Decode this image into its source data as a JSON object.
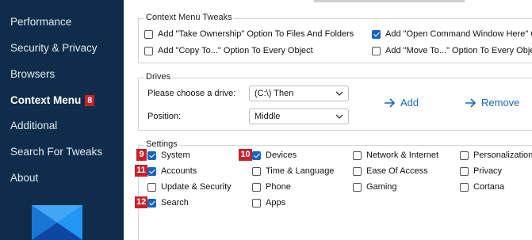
{
  "sidebar": {
    "items": [
      {
        "label": "Performance"
      },
      {
        "label": "Security & Privacy"
      },
      {
        "label": "Browsers"
      },
      {
        "label": "Context Menu",
        "badge": "8"
      },
      {
        "label": "Additional"
      },
      {
        "label": "Search For Tweaks"
      },
      {
        "label": "About"
      }
    ],
    "active_index": 3
  },
  "context_menu_tweaks": {
    "title": "Context Menu Tweaks",
    "options": [
      {
        "label": "Add \"Take Ownership\" Option To Files And Folders",
        "checked": false
      },
      {
        "label": "Add \"Open Command Window Here\" Optio",
        "checked": true
      },
      {
        "label": "Add \"Copy To...\" Option To Every Object",
        "checked": false
      },
      {
        "label": "Add \"Move To...\" Option To Every Object",
        "checked": false
      }
    ]
  },
  "drives": {
    "title": "Drives",
    "drive_label": "Please choose a drive:",
    "drive_value": "(C:\\) Then",
    "position_label": "Position:",
    "position_value": "Middle",
    "add_label": "Add",
    "remove_label": "Remove"
  },
  "settings": {
    "title": "Settings",
    "items": [
      {
        "label": "System",
        "checked": true,
        "marker": "9"
      },
      {
        "label": "Devices",
        "checked": true,
        "marker": "10"
      },
      {
        "label": "Network & Internet",
        "checked": false
      },
      {
        "label": "Personalization",
        "checked": false
      },
      {
        "label": "Accounts",
        "checked": true,
        "marker": "11"
      },
      {
        "label": "Time & Language",
        "checked": false
      },
      {
        "label": "Ease Of Access",
        "checked": false
      },
      {
        "label": "Privacy",
        "checked": false
      },
      {
        "label": "Update & Security",
        "checked": false
      },
      {
        "label": "Phone",
        "checked": false
      },
      {
        "label": "Gaming",
        "checked": false
      },
      {
        "label": "Cortana",
        "checked": false
      },
      {
        "label": "Search",
        "checked": true,
        "marker": "12"
      },
      {
        "label": "Apps",
        "checked": false
      }
    ]
  },
  "colors": {
    "sidebar_bg": "#0f2d4a",
    "accent": "#1565c0",
    "badge_red": "#c8202a"
  }
}
